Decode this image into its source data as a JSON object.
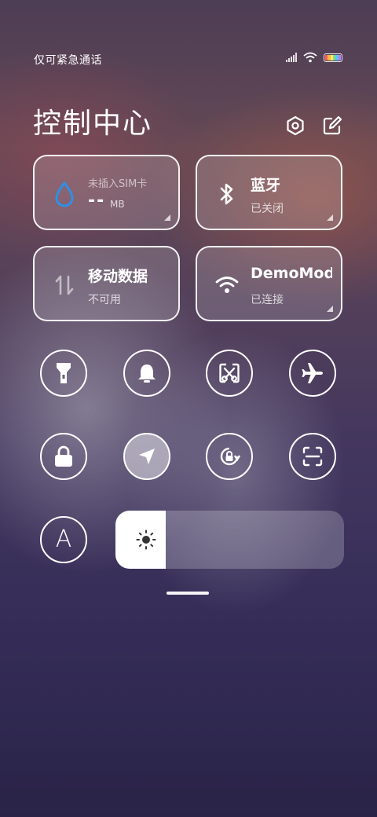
{
  "status_bar": {
    "carrier_text": "仅可紧急通话"
  },
  "header": {
    "title": "控制中心"
  },
  "tiles": {
    "data_usage": {
      "main": "--",
      "unit": "MB",
      "sub": "未插入SIM卡"
    },
    "bluetooth": {
      "main": "蓝牙",
      "sub": "已关闭"
    },
    "mobile_data": {
      "main": "移动数据",
      "sub": "不可用"
    },
    "wifi": {
      "main": "DemoMod",
      "sub": "已连接"
    }
  },
  "toggles": [
    {
      "icon": "flashlight-icon",
      "active": false
    },
    {
      "icon": "bell-icon",
      "active": false
    },
    {
      "icon": "screenshot-icon",
      "active": false
    },
    {
      "icon": "airplane-icon",
      "active": false
    },
    {
      "icon": "lock-icon",
      "active": false
    },
    {
      "icon": "location-icon",
      "active": true
    },
    {
      "icon": "rotation-lock-icon",
      "active": false
    },
    {
      "icon": "scan-icon",
      "active": false
    }
  ],
  "auto_brightness": {
    "label": "A"
  },
  "brightness": {
    "level": 0.22
  },
  "colors": {
    "accent_drop": "#2f8fe6",
    "tile_border": "#ffffff"
  }
}
